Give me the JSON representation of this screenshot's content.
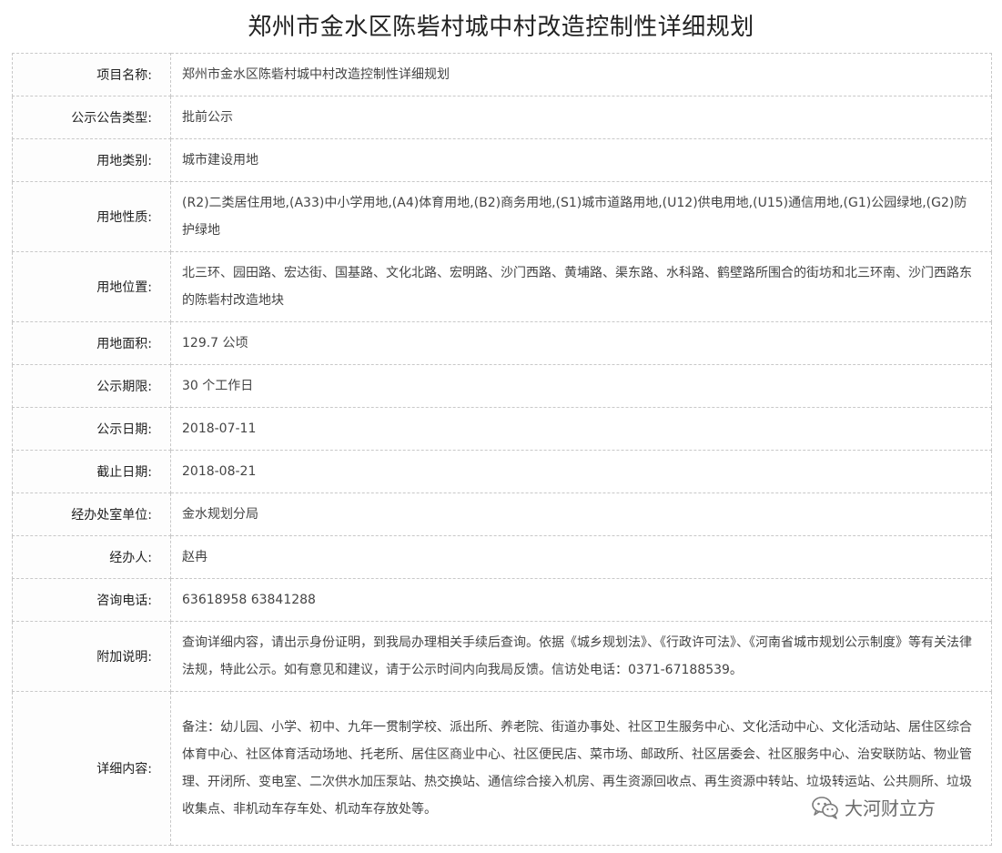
{
  "page_title": "郑州市金水区陈砦村城中村改造控制性详细规划",
  "rows": [
    {
      "label": "项目名称:",
      "value": "郑州市金水区陈砦村城中村改造控制性详细规划"
    },
    {
      "label": "公示公告类型:",
      "value": "批前公示"
    },
    {
      "label": "用地类别:",
      "value": "城市建设用地"
    },
    {
      "label": "用地性质:",
      "value": "(R2)二类居住用地,(A33)中小学用地,(A4)体育用地,(B2)商务用地,(S1)城市道路用地,(U12)供电用地,(U15)通信用地,(G1)公园绿地,(G2)防护绿地"
    },
    {
      "label": "用地位置:",
      "value": "北三环、园田路、宏达街、国基路、文化北路、宏明路、沙门西路、黄埔路、渠东路、水科路、鹤壁路所围合的街坊和北三环南、沙门西路东的陈砦村改造地块"
    },
    {
      "label": "用地面积:",
      "value": "129.7 公顷"
    },
    {
      "label": "公示期限:",
      "value": "30 个工作日"
    },
    {
      "label": "公示日期:",
      "value": "2018-07-11"
    },
    {
      "label": "截止日期:",
      "value": "2018-08-21"
    },
    {
      "label": "经办处室单位:",
      "value": "金水规划分局"
    },
    {
      "label": "经办人:",
      "value": "赵冉"
    },
    {
      "label": "咨询电话:",
      "value": "63618958 63841288"
    },
    {
      "label": "附加说明:",
      "value": "查询详细内容，请出示身份证明，到我局办理相关手续后查询。依据《城乡规划法》、《行政许可法》、《河南省城市规划公示制度》等有关法律法规，特此公示。如有意见和建议，请于公示时间内向我局反馈。信访处电话：0371-67188539。"
    },
    {
      "label": "详细内容:",
      "value": "备注：幼儿园、小学、初中、九年一贯制学校、派出所、养老院、街道办事处、社区卫生服务中心、文化活动中心、文化活动站、居住区综合体育中心、社区体育活动场地、托老所、居住区商业中心、社区便民店、菜市场、邮政所、社区居委会、社区服务中心、治安联防站、物业管理、开闭所、变电室、二次供水加压泵站、热交换站、通信综合接入机房、再生资源回收点、再生资源中转站、垃圾转运站、公共厕所、垃圾收集点、非机动车存车处、机动车存放处等。"
    }
  ],
  "watermark": {
    "icon": "wechat-icon",
    "text": "大河财立方"
  }
}
